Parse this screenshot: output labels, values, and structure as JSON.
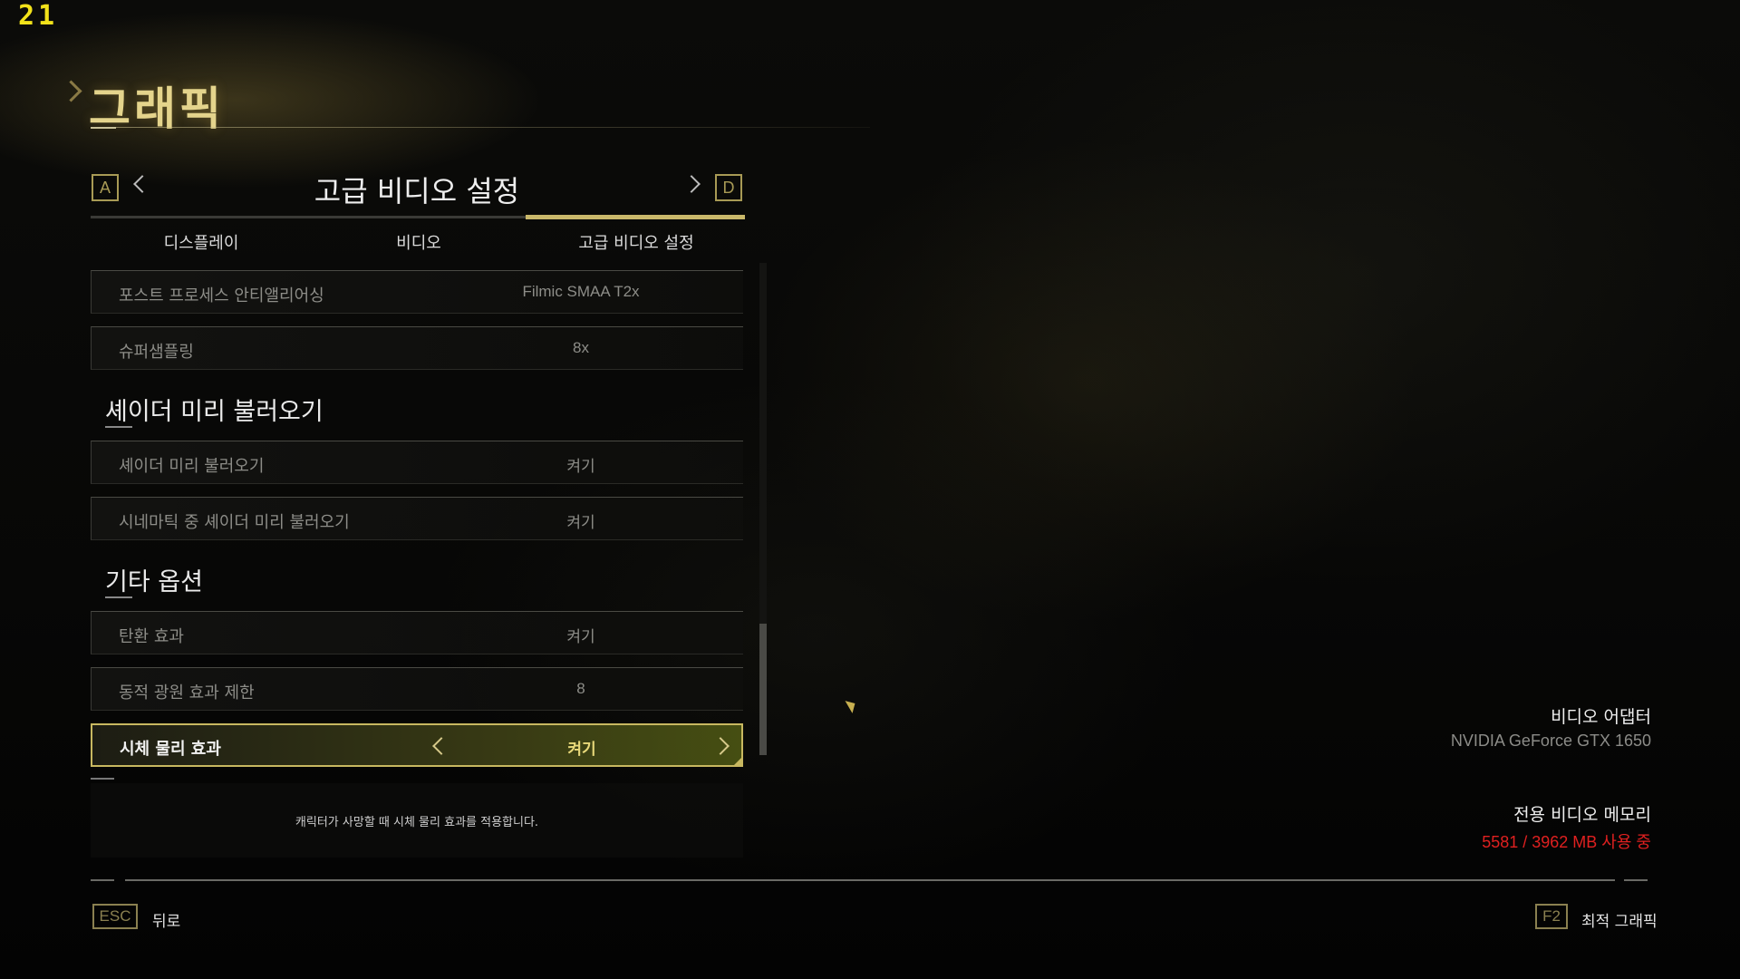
{
  "overlay": {
    "fps": "21"
  },
  "page": {
    "title": "그래픽"
  },
  "header": {
    "left_key": "A",
    "right_key": "D",
    "section_title": "고급 비디오 설정"
  },
  "tabs": [
    {
      "label": "디스플레이"
    },
    {
      "label": "비디오"
    },
    {
      "label": "고급 비디오 설정",
      "active": true
    }
  ],
  "settings": {
    "row_post_aa": {
      "label": "포스트 프로세스 안티앨리어싱",
      "value": "Filmic SMAA T2x"
    },
    "row_supersampling": {
      "label": "슈퍼샘플링",
      "value": "8x"
    },
    "group_shader": {
      "title": "셰이더 미리 불러오기"
    },
    "row_shader_preload": {
      "label": "셰이더 미리 불러오기",
      "value": "켜기"
    },
    "row_cinematic_shader": {
      "label": "시네마틱 중 셰이더 미리 불러오기",
      "value": "켜기"
    },
    "group_other": {
      "title": "기타 옵션"
    },
    "row_shell_effect": {
      "label": "탄환 효과",
      "value": "켜기"
    },
    "row_dynamic_light": {
      "label": "동적 광원 효과 제한",
      "value": "8"
    },
    "row_ragdoll": {
      "label": "시체 물리 효과",
      "value": "켜기",
      "selected": true
    }
  },
  "description": {
    "text": "캐릭터가 사망할 때 시체 물리 효과를 적용합니다."
  },
  "info": {
    "adapter_label": "비디오 어댑터",
    "adapter_value": "NVIDIA GeForce GTX 1650",
    "memory_label": "전용 비디오 메모리",
    "memory_value": "5581 / 3962 MB 사용 중"
  },
  "footer": {
    "back_key": "ESC",
    "back_label": "뒤로",
    "optimal_key": "F2",
    "optimal_label": "최적 그래픽"
  },
  "colors": {
    "accent": "#c8b860",
    "warning": "#e02020",
    "fps": "#f2e21a"
  },
  "scrollbar": {
    "position_fraction": 0.73
  }
}
